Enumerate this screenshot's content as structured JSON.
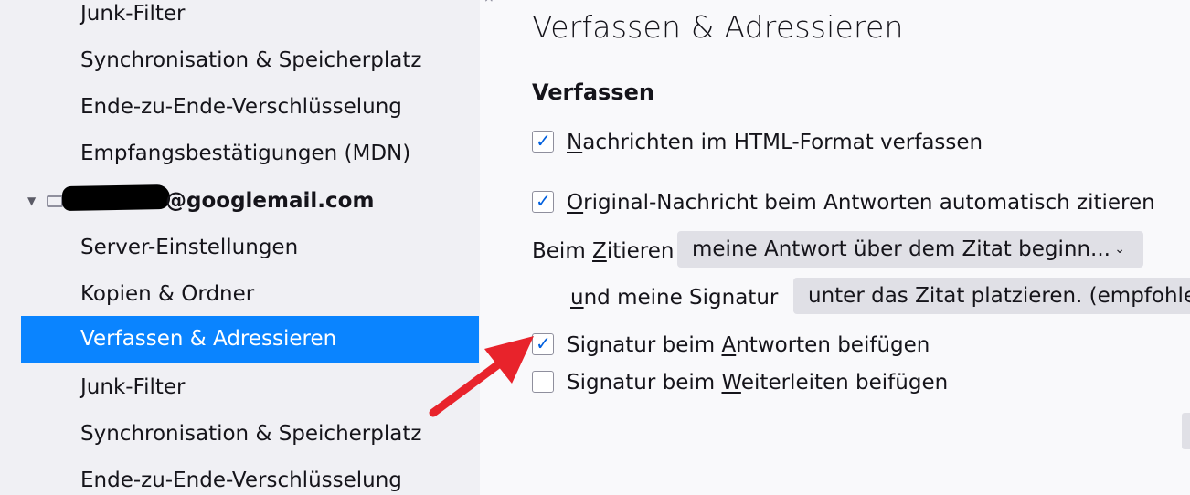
{
  "sidebar": {
    "items_top": [
      {
        "label": "Junk-Filter"
      },
      {
        "label": "Synchronisation & Speicherplatz"
      },
      {
        "label": "Ende-zu-Ende-Verschlüsselung"
      },
      {
        "label": "Empfangsbestätigungen (MDN)"
      }
    ],
    "account": {
      "label": "@googlemail.com",
      "icon": "mail-account-icon",
      "twisty": "chevron-down-icon"
    },
    "items_bottom": [
      {
        "label": "Server-Einstellungen"
      },
      {
        "label": "Kopien & Ordner"
      },
      {
        "label": "Verfassen & Adressieren",
        "selected": true
      },
      {
        "label": "Junk-Filter"
      },
      {
        "label": "Synchronisation & Speicherplatz"
      },
      {
        "label": "Ende-zu-Ende-Verschlüsselung"
      }
    ]
  },
  "main": {
    "title": "Verfassen & Adressieren",
    "section": "Verfassen",
    "html_format": {
      "accesskey": "N",
      "rest": "achrichten im HTML-Format verfassen",
      "checked": true
    },
    "auto_quote": {
      "accesskey": "O",
      "rest": "riginal-Nachricht beim Antworten automatisch zitieren",
      "checked": true
    },
    "quote_label": {
      "pre": "Beim ",
      "accesskey": "Z",
      "rest": "itieren"
    },
    "quote_select": {
      "value": "meine Antwort über dem Zitat beginn..."
    },
    "signature_label": {
      "accesskey": "u",
      "rest": "nd meine Signatur"
    },
    "signature_select": {
      "value": "unter das Zitat platzieren. (empfohlen)"
    },
    "sig_reply": {
      "pre": "Signatur beim ",
      "accesskey": "A",
      "rest": "ntworten beifügen",
      "checked": true
    },
    "sig_forward": {
      "pre": "Signatur beim ",
      "accesskey": "W",
      "rest": "eiterleiten beifügen",
      "checked": false
    }
  },
  "colors": {
    "selection": "#0a84ff",
    "arrow": "#e8232b",
    "checkmark": "#0060df"
  }
}
